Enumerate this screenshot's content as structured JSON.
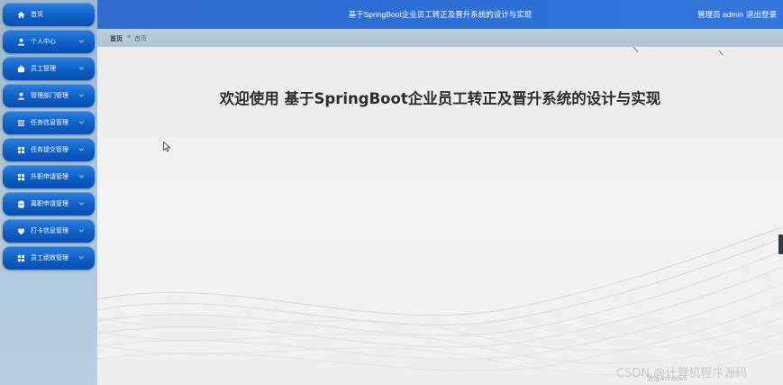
{
  "topbar": {
    "title": "基于SpringBoot企业员工转正及晋升系统的设计与实现",
    "user": "管理员 admin",
    "logout": "退出登录"
  },
  "sidebar": {
    "items": [
      {
        "label": "首页",
        "icon": "home-icon",
        "has_chevron": false
      },
      {
        "label": "个人中心",
        "icon": "user-icon",
        "has_chevron": true
      },
      {
        "label": "员工管理",
        "icon": "briefcase-icon",
        "has_chevron": true
      },
      {
        "label": "管理部门管理",
        "icon": "user-icon",
        "has_chevron": true
      },
      {
        "label": "任务信息管理",
        "icon": "list-icon",
        "has_chevron": true
      },
      {
        "label": "任务提交管理",
        "icon": "grid-icon",
        "has_chevron": true
      },
      {
        "label": "升职申请管理",
        "icon": "grid-icon",
        "has_chevron": true
      },
      {
        "label": "离职申请管理",
        "icon": "clipboard-icon",
        "has_chevron": true
      },
      {
        "label": "打卡信息管理",
        "icon": "heart-icon",
        "has_chevron": true
      },
      {
        "label": "员工绩效管理",
        "icon": "grid-icon",
        "has_chevron": true
      }
    ]
  },
  "breadcrumb": {
    "home": "首页",
    "separator": "≡",
    "current": "首页"
  },
  "main": {
    "welcome": "欢迎使用 基于SpringBoot企业员工转正及晋升系统的设计与实现"
  },
  "watermarks": {
    "windows": "激活 Windows",
    "csdn": "CSDN @计算机程序源码"
  },
  "colors": {
    "sidebar_button": "#0e5fc6",
    "topbar": "#2f6ccd",
    "sidebar_bg": "#a9c3d8",
    "content_bg": "#eeeeee"
  }
}
